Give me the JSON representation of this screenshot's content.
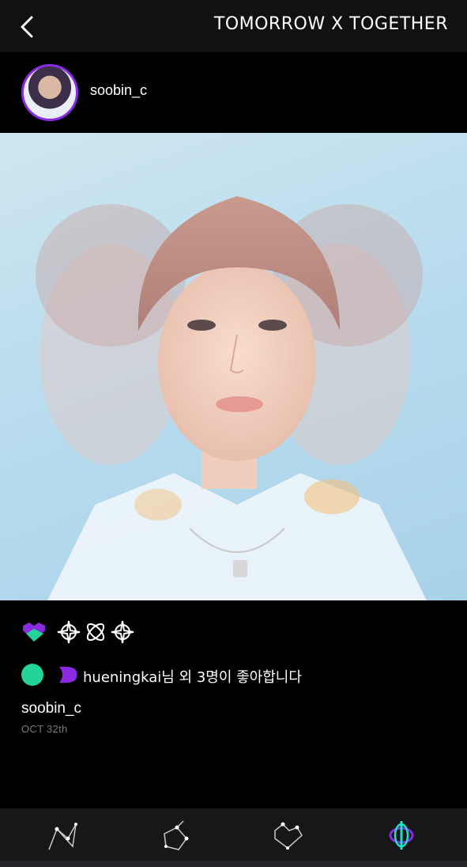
{
  "header": {
    "brand": "TOMORROW X TOGETHER",
    "back_icon": "chevron-left-icon"
  },
  "post": {
    "username": "soobin_c",
    "avatar": "profile-avatar",
    "photo": "portrait-photo",
    "actions": [
      "heart-icon",
      "sparkle-constellation-icon",
      "atom-constellation-icon",
      "sparkle-constellation-icon-2"
    ],
    "likes_text": "hueningkai님 외 3명이 좋아합니다",
    "caption_user": "soobin_c",
    "date": "OCT 32th"
  },
  "bottom_nav": {
    "items": [
      "constellation-1-icon",
      "constellation-2-icon",
      "constellation-3-icon",
      "txt-logo-icon"
    ]
  },
  "colors": {
    "accent_purple": "#8a2be2",
    "accent_green": "#22d39a",
    "nav_active_teal": "#1fe0c8",
    "background": "#000000"
  }
}
